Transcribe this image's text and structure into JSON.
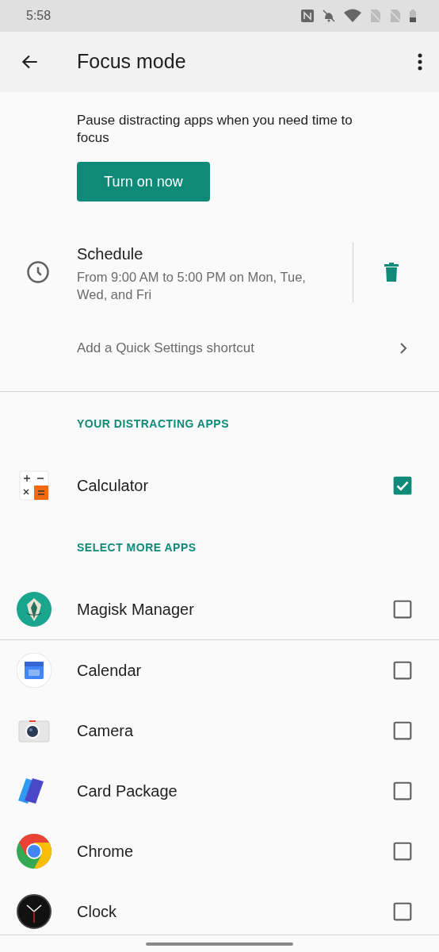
{
  "status_bar": {
    "time": "5:58"
  },
  "app_bar": {
    "title": "Focus mode"
  },
  "intro": {
    "text": "Pause distracting apps when you need time to focus",
    "button": "Turn on now"
  },
  "schedule": {
    "title": "Schedule",
    "summary": "From 9:00 AM to 5:00 PM on Mon, Tue, Wed, and Fri"
  },
  "shortcut": {
    "label": "Add a Quick Settings shortcut"
  },
  "sections": [
    {
      "header": "YOUR DISTRACTING APPS",
      "apps": [
        {
          "name": "Calculator",
          "checked": true
        }
      ]
    },
    {
      "header": "SELECT MORE APPS",
      "apps": [
        {
          "name": "Magisk Manager",
          "checked": false
        },
        {
          "name": "Calendar",
          "checked": false
        },
        {
          "name": "Camera",
          "checked": false
        },
        {
          "name": "Card Package",
          "checked": false
        },
        {
          "name": "Chrome",
          "checked": false
        },
        {
          "name": "Clock",
          "checked": false
        }
      ]
    }
  ]
}
